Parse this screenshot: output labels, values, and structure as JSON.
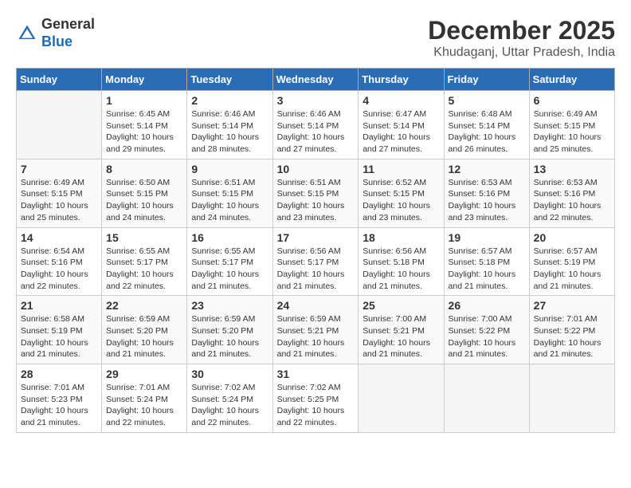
{
  "header": {
    "logo_general": "General",
    "logo_blue": "Blue",
    "month": "December 2025",
    "location": "Khudaganj, Uttar Pradesh, India"
  },
  "weekdays": [
    "Sunday",
    "Monday",
    "Tuesday",
    "Wednesday",
    "Thursday",
    "Friday",
    "Saturday"
  ],
  "weeks": [
    [
      {
        "day": "",
        "info": ""
      },
      {
        "day": "1",
        "info": "Sunrise: 6:45 AM\nSunset: 5:14 PM\nDaylight: 10 hours\nand 29 minutes."
      },
      {
        "day": "2",
        "info": "Sunrise: 6:46 AM\nSunset: 5:14 PM\nDaylight: 10 hours\nand 28 minutes."
      },
      {
        "day": "3",
        "info": "Sunrise: 6:46 AM\nSunset: 5:14 PM\nDaylight: 10 hours\nand 27 minutes."
      },
      {
        "day": "4",
        "info": "Sunrise: 6:47 AM\nSunset: 5:14 PM\nDaylight: 10 hours\nand 27 minutes."
      },
      {
        "day": "5",
        "info": "Sunrise: 6:48 AM\nSunset: 5:14 PM\nDaylight: 10 hours\nand 26 minutes."
      },
      {
        "day": "6",
        "info": "Sunrise: 6:49 AM\nSunset: 5:15 PM\nDaylight: 10 hours\nand 25 minutes."
      }
    ],
    [
      {
        "day": "7",
        "info": "Sunrise: 6:49 AM\nSunset: 5:15 PM\nDaylight: 10 hours\nand 25 minutes."
      },
      {
        "day": "8",
        "info": "Sunrise: 6:50 AM\nSunset: 5:15 PM\nDaylight: 10 hours\nand 24 minutes."
      },
      {
        "day": "9",
        "info": "Sunrise: 6:51 AM\nSunset: 5:15 PM\nDaylight: 10 hours\nand 24 minutes."
      },
      {
        "day": "10",
        "info": "Sunrise: 6:51 AM\nSunset: 5:15 PM\nDaylight: 10 hours\nand 23 minutes."
      },
      {
        "day": "11",
        "info": "Sunrise: 6:52 AM\nSunset: 5:15 PM\nDaylight: 10 hours\nand 23 minutes."
      },
      {
        "day": "12",
        "info": "Sunrise: 6:53 AM\nSunset: 5:16 PM\nDaylight: 10 hours\nand 23 minutes."
      },
      {
        "day": "13",
        "info": "Sunrise: 6:53 AM\nSunset: 5:16 PM\nDaylight: 10 hours\nand 22 minutes."
      }
    ],
    [
      {
        "day": "14",
        "info": "Sunrise: 6:54 AM\nSunset: 5:16 PM\nDaylight: 10 hours\nand 22 minutes."
      },
      {
        "day": "15",
        "info": "Sunrise: 6:55 AM\nSunset: 5:17 PM\nDaylight: 10 hours\nand 22 minutes."
      },
      {
        "day": "16",
        "info": "Sunrise: 6:55 AM\nSunset: 5:17 PM\nDaylight: 10 hours\nand 21 minutes."
      },
      {
        "day": "17",
        "info": "Sunrise: 6:56 AM\nSunset: 5:17 PM\nDaylight: 10 hours\nand 21 minutes."
      },
      {
        "day": "18",
        "info": "Sunrise: 6:56 AM\nSunset: 5:18 PM\nDaylight: 10 hours\nand 21 minutes."
      },
      {
        "day": "19",
        "info": "Sunrise: 6:57 AM\nSunset: 5:18 PM\nDaylight: 10 hours\nand 21 minutes."
      },
      {
        "day": "20",
        "info": "Sunrise: 6:57 AM\nSunset: 5:19 PM\nDaylight: 10 hours\nand 21 minutes."
      }
    ],
    [
      {
        "day": "21",
        "info": "Sunrise: 6:58 AM\nSunset: 5:19 PM\nDaylight: 10 hours\nand 21 minutes."
      },
      {
        "day": "22",
        "info": "Sunrise: 6:59 AM\nSunset: 5:20 PM\nDaylight: 10 hours\nand 21 minutes."
      },
      {
        "day": "23",
        "info": "Sunrise: 6:59 AM\nSunset: 5:20 PM\nDaylight: 10 hours\nand 21 minutes."
      },
      {
        "day": "24",
        "info": "Sunrise: 6:59 AM\nSunset: 5:21 PM\nDaylight: 10 hours\nand 21 minutes."
      },
      {
        "day": "25",
        "info": "Sunrise: 7:00 AM\nSunset: 5:21 PM\nDaylight: 10 hours\nand 21 minutes."
      },
      {
        "day": "26",
        "info": "Sunrise: 7:00 AM\nSunset: 5:22 PM\nDaylight: 10 hours\nand 21 minutes."
      },
      {
        "day": "27",
        "info": "Sunrise: 7:01 AM\nSunset: 5:22 PM\nDaylight: 10 hours\nand 21 minutes."
      }
    ],
    [
      {
        "day": "28",
        "info": "Sunrise: 7:01 AM\nSunset: 5:23 PM\nDaylight: 10 hours\nand 21 minutes."
      },
      {
        "day": "29",
        "info": "Sunrise: 7:01 AM\nSunset: 5:24 PM\nDaylight: 10 hours\nand 22 minutes."
      },
      {
        "day": "30",
        "info": "Sunrise: 7:02 AM\nSunset: 5:24 PM\nDaylight: 10 hours\nand 22 minutes."
      },
      {
        "day": "31",
        "info": "Sunrise: 7:02 AM\nSunset: 5:25 PM\nDaylight: 10 hours\nand 22 minutes."
      },
      {
        "day": "",
        "info": ""
      },
      {
        "day": "",
        "info": ""
      },
      {
        "day": "",
        "info": ""
      }
    ]
  ]
}
